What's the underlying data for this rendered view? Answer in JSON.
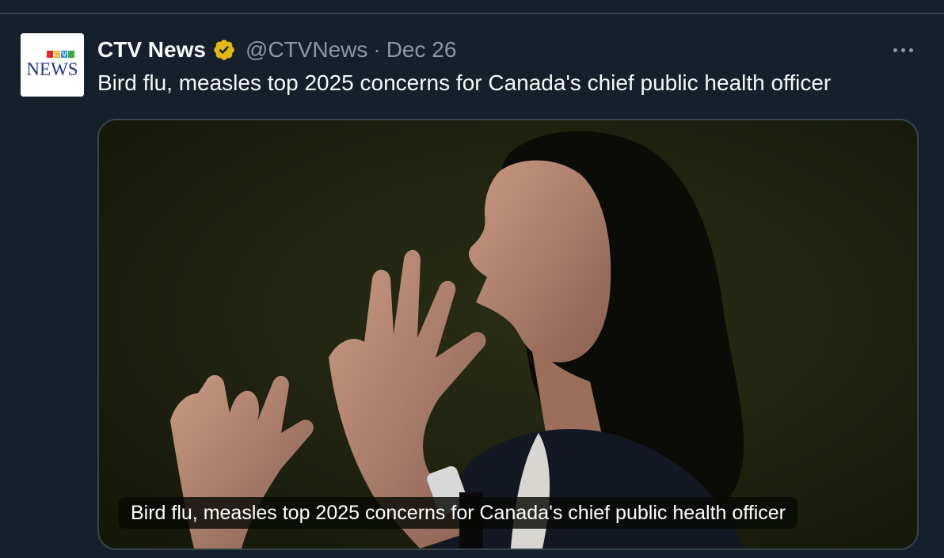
{
  "tweet": {
    "author": {
      "display_name": "CTV News",
      "handle": "@CTVNews",
      "verified": true,
      "verified_badge_color": "#e2b719",
      "avatar_logo": {
        "top": "CTV",
        "bottom": "NEWS"
      }
    },
    "separator": "·",
    "date": "Dec 26",
    "text": "Bird flu, measles top 2025 concerns for Canada's chief public health officer",
    "media": {
      "type": "photo",
      "caption": "Bird flu, measles top 2025 concerns for Canada's chief public health officer"
    }
  },
  "icons": {
    "verified": "verified-badge-icon",
    "more": "more-horizontal-icon"
  },
  "colors": {
    "background": "#15202b",
    "divider": "#38444d",
    "secondary_text": "#8b98a5",
    "primary_text": "#f7f9f9"
  }
}
